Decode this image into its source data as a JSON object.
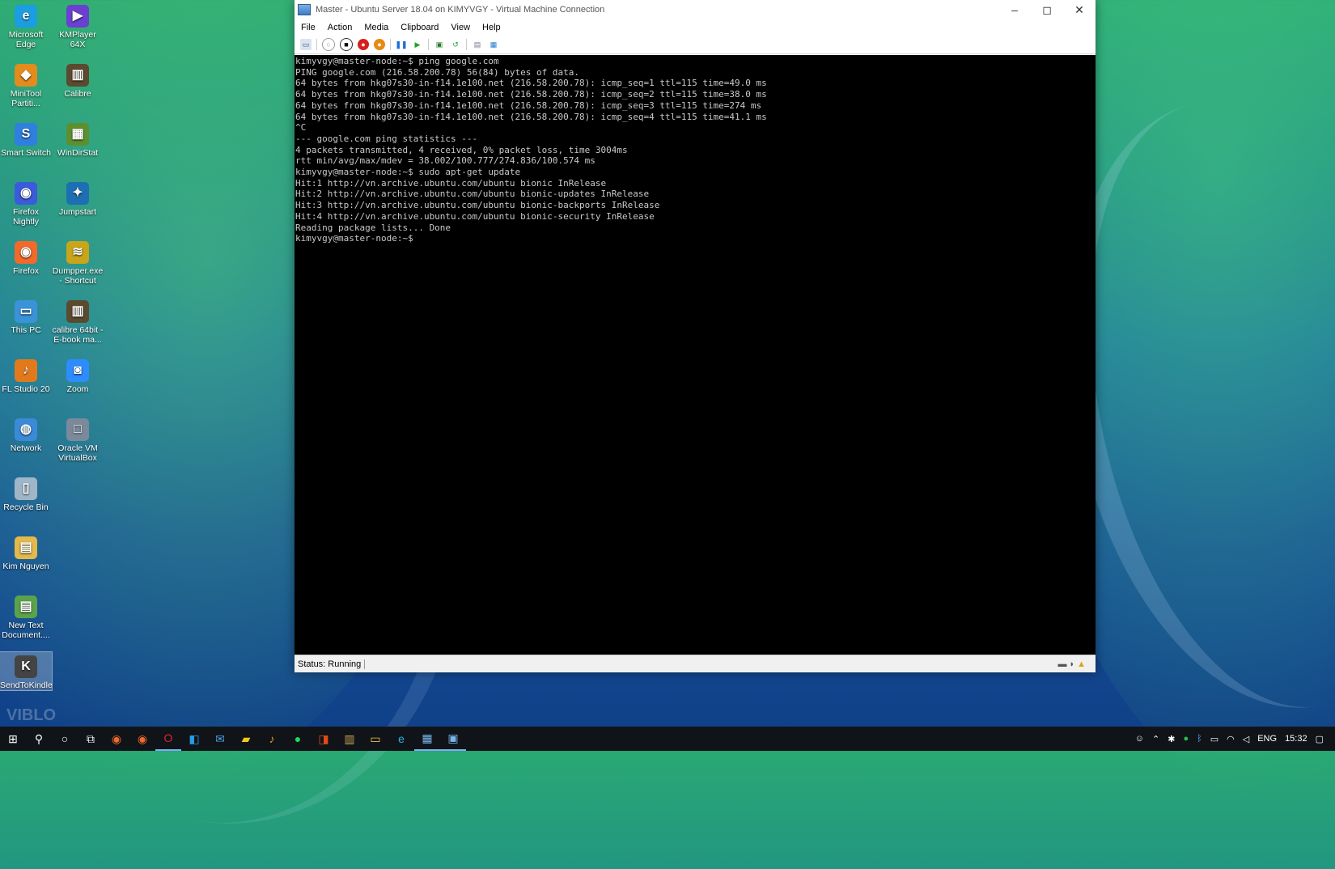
{
  "desktop": {
    "icons": [
      {
        "label": "Microsoft Edge",
        "symbol": "e",
        "color": "#1b9de2"
      },
      {
        "label": "KMPlayer 64X",
        "symbol": "▶",
        "color": "#6b3fd0"
      },
      {
        "label": "MiniTool Partiti...",
        "symbol": "◆",
        "color": "#e48b1d"
      },
      {
        "label": "Calibre",
        "symbol": "▥",
        "color": "#5b4a2f"
      },
      {
        "label": "Smart Switch",
        "symbol": "S",
        "color": "#2f7fe0"
      },
      {
        "label": "WinDirStat",
        "symbol": "▦",
        "color": "#5e8f2f"
      },
      {
        "label": "Firefox Nightly",
        "symbol": "◉",
        "color": "#3b5bdb"
      },
      {
        "label": "Jumpstart",
        "symbol": "✦",
        "color": "#1c6fb3"
      },
      {
        "label": "Firefox",
        "symbol": "◉",
        "color": "#f3692a"
      },
      {
        "label": "Dumpper.exe - Shortcut",
        "symbol": "≋",
        "color": "#c9a51a"
      },
      {
        "label": "This PC",
        "symbol": "▭",
        "color": "#3a93d9"
      },
      {
        "label": "calibre 64bit - E-book ma...",
        "symbol": "▥",
        "color": "#5b4a2f"
      },
      {
        "label": "FL Studio 20",
        "symbol": "♪",
        "color": "#e27a1c"
      },
      {
        "label": "Zoom",
        "symbol": "◙",
        "color": "#2d8cff"
      },
      {
        "label": "Network",
        "symbol": "◍",
        "color": "#3a8ad8"
      },
      {
        "label": "Oracle VM VirtualBox",
        "symbol": "□",
        "color": "#7a8a9a"
      },
      {
        "label": "Recycle Bin",
        "symbol": "▯",
        "color": "#9fb6c9"
      },
      {
        "label": "Kim Nguyen",
        "symbol": "▤",
        "color": "#e3b94a"
      },
      {
        "label": "New Text Document....",
        "symbol": "▤",
        "color": "#5ba34a"
      },
      {
        "label": "SendToKindle",
        "symbol": "K",
        "color": "#444444"
      }
    ]
  },
  "window": {
    "title": "Master - Ubuntu Server 18.04 on KIMYVGY - Virtual Machine Connection",
    "menu": [
      "File",
      "Action",
      "Media",
      "Clipboard",
      "View",
      "Help"
    ],
    "terminal_lines": [
      "kimyvgy@master-node:~$ ping google.com",
      "PING google.com (216.58.200.78) 56(84) bytes of data.",
      "64 bytes from hkg07s30-in-f14.1e100.net (216.58.200.78): icmp_seq=1 ttl=115 time=49.0 ms",
      "64 bytes from hkg07s30-in-f14.1e100.net (216.58.200.78): icmp_seq=2 ttl=115 time=38.0 ms",
      "64 bytes from hkg07s30-in-f14.1e100.net (216.58.200.78): icmp_seq=3 ttl=115 time=274 ms",
      "64 bytes from hkg07s30-in-f14.1e100.net (216.58.200.78): icmp_seq=4 ttl=115 time=41.1 ms",
      "^C",
      "--- google.com ping statistics ---",
      "4 packets transmitted, 4 received, 0% packet loss, time 3004ms",
      "rtt min/avg/max/mdev = 38.002/100.777/274.836/100.574 ms",
      "kimyvgy@master-node:~$ sudo apt-get update",
      "Hit:1 http://vn.archive.ubuntu.com/ubuntu bionic InRelease",
      "Hit:2 http://vn.archive.ubuntu.com/ubuntu bionic-updates InRelease",
      "Hit:3 http://vn.archive.ubuntu.com/ubuntu bionic-backports InRelease",
      "Hit:4 http://vn.archive.ubuntu.com/ubuntu bionic-security InRelease",
      "Reading package lists... Done",
      "kimyvgy@master-node:~$"
    ],
    "status": "Status: Running"
  },
  "taskbar": {
    "language": "ENG",
    "time": "15:32"
  },
  "watermark": "VIBLO"
}
